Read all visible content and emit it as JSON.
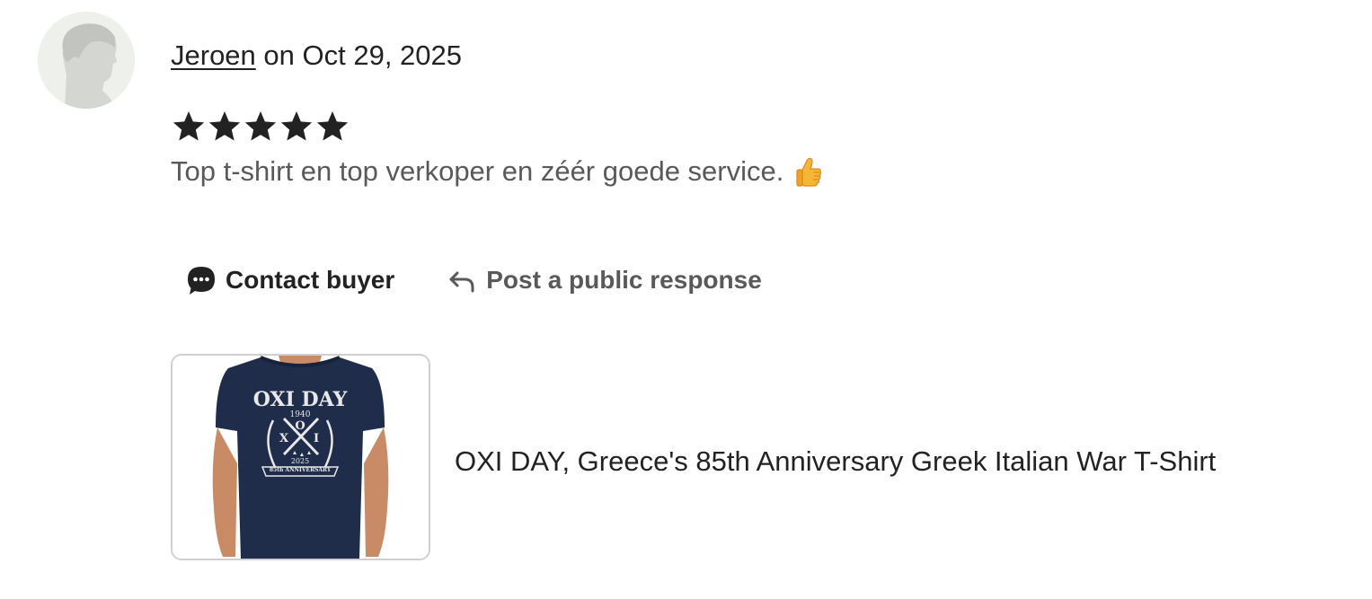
{
  "review": {
    "reviewer_name": "Jeroen",
    "date_prefix": " on ",
    "date": "Oct 29, 2025",
    "rating": 5,
    "rating_max": 5,
    "text": "Top t-shirt en top verkoper en zéér goede service.",
    "emoji_icon": "thumbs-up-emoji"
  },
  "actions": {
    "contact_label": "Contact buyer",
    "contact_icon": "chat-bubble-icon",
    "respond_label": "Post a public response",
    "respond_icon": "reply-arrow-icon"
  },
  "product": {
    "title": "OXI DAY, Greece's 85th Anniversary Greek Italian War T-Shirt",
    "image_text": {
      "headline": "OXI DAY",
      "year_start": "1940",
      "year_end": "2025",
      "banner": "85th ANNIVERSARY",
      "letters_left": "Χ",
      "letters_right": "Ι",
      "top_letter": "Ο"
    }
  },
  "colors": {
    "text_primary": "#222222",
    "text_secondary": "#595959",
    "star": "#222222",
    "shirt": "#1f2d4a",
    "border": "#cfcfcf"
  }
}
